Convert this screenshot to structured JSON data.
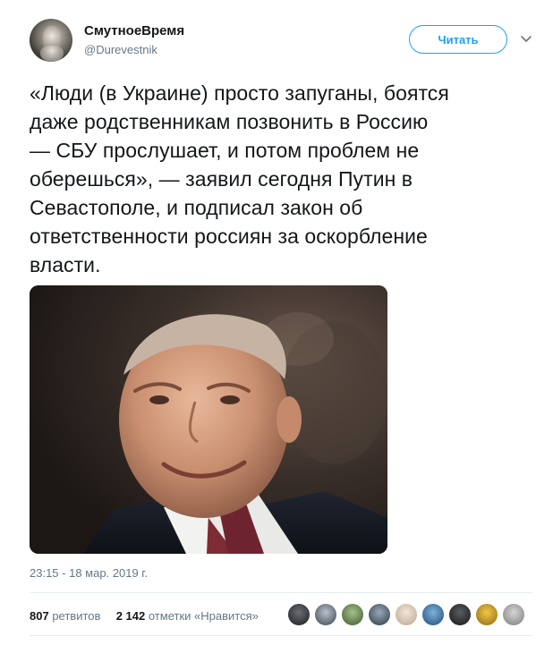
{
  "author": {
    "display_name": "СмутноеВремя",
    "handle": "@Durevestnik",
    "avatar_icon": "bearded-man-avatar"
  },
  "actions": {
    "follow_label": "Читать",
    "menu_icon": "chevron-down-icon"
  },
  "tweet": {
    "lines": [
      "«Люди (в Украине) просто запуганы, боятся",
      "даже родственникам позвонить в Россию",
      "— СБУ прослушает, и потом проблем не",
      "оберешься», — заявил сегодня Путин в",
      "Севастополе, и подписал закон об",
      "ответственности россиян за оскорбление",
      "власти."
    ],
    "photo_icon": "man-in-suit-smiling-photo",
    "timestamp": "23:15 - 18 мар. 2019 г."
  },
  "stats": {
    "retweets_count": "807",
    "retweets_label": "ретвитов",
    "likes_count": "2 142",
    "likes_label": "отметки «Нравится»"
  },
  "liker_avatars": [
    "liker-avatar",
    "liker-avatar",
    "liker-avatar",
    "liker-avatar",
    "liker-avatar",
    "liker-avatar",
    "liker-avatar",
    "liker-avatar",
    "liker-avatar"
  ],
  "colors": {
    "accent": "#1da1f2",
    "text": "#14171a",
    "secondary_text": "#657786",
    "divider": "#e6ecf0"
  }
}
